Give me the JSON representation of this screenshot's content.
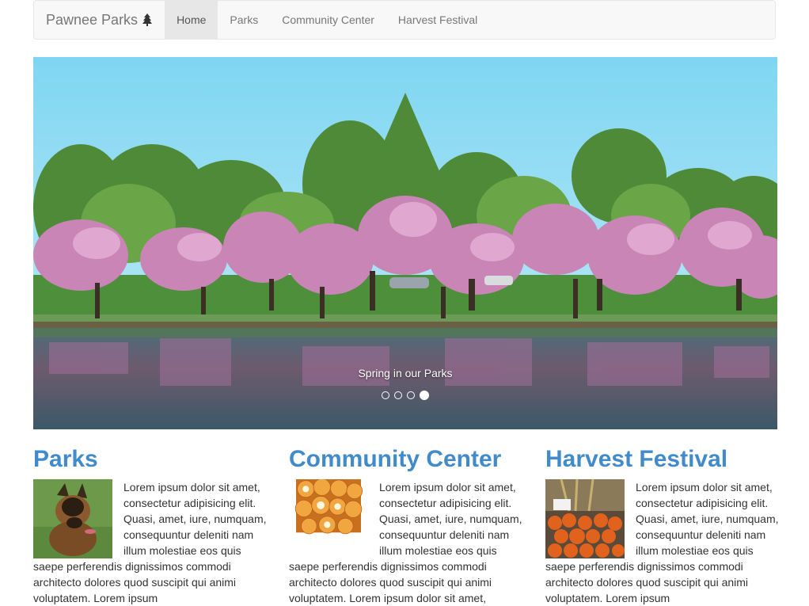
{
  "navbar": {
    "brand": "Pawnee Parks",
    "brand_icon": "tree-icon",
    "items": [
      {
        "label": "Home",
        "active": true
      },
      {
        "label": "Parks",
        "active": false
      },
      {
        "label": "Community Center",
        "active": false
      },
      {
        "label": "Harvest Festival",
        "active": false
      }
    ]
  },
  "carousel": {
    "caption": "Spring in our Parks",
    "slide_count": 4,
    "active_index": 3
  },
  "sections": [
    {
      "title": "Parks",
      "thumb": "dog-photo",
      "text": "Lorem ipsum dolor sit amet, consectetur adipisicing elit. Quasi, amet, iure, numquam, consequuntur deleniti nam illum molestiae eos quis saepe perferendis dignissimos commodi architecto dolores quod suscipit qui animi voluptatem. Lorem ipsum"
    },
    {
      "title": "Community Center",
      "thumb": "bingo-balls-photo",
      "text": "Lorem ipsum dolor sit amet, consectetur adipisicing elit. Quasi, amet, iure, numquam, consequuntur deleniti nam illum molestiae eos quis saepe perferendis dignissimos commodi architecto dolores quod suscipit qui animi voluptatem. Lorem ipsum dolor sit amet,"
    },
    {
      "title": "Harvest Festival",
      "thumb": "pumpkins-photo",
      "text": "Lorem ipsum dolor sit amet, consectetur adipisicing elit. Quasi, amet, iure, numquam, consequuntur deleniti nam illum molestiae eos quis saepe perferendis dignissimos commodi architecto dolores quod suscipit qui animi voluptatem. Lorem ipsum"
    }
  ],
  "colors": {
    "link": "#428bca",
    "navbar_bg": "#f8f8f8",
    "active_nav_bg": "#e7e7e7"
  }
}
